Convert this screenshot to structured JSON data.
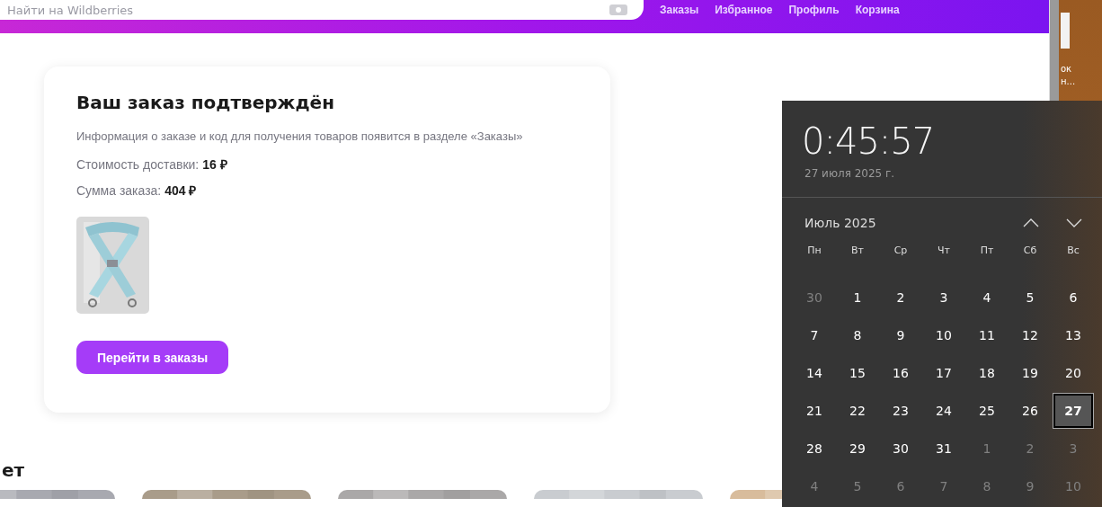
{
  "header": {
    "search": {
      "placeholder": "Найти на Wildberries"
    },
    "nav": [
      "Заказы",
      "Избранное",
      "Профиль",
      "Корзина"
    ]
  },
  "order_card": {
    "title": "Ваш заказ подтверждён",
    "info": "Информация о заказе и код для получения товаров появится в разделе «Заказы»",
    "lines": [
      {
        "label": "Стоимость доставки:",
        "value": "16 ₽"
      },
      {
        "label": "Сумма заказа:",
        "value": "404 ₽"
      }
    ],
    "button": "Перейти в заказы"
  },
  "section_heading": "ет",
  "desktop_icon": {
    "label": "ок\nн..."
  },
  "clock": {
    "time": "0:45:57",
    "date": "27 июля 2025 г.",
    "month": "Июль 2025",
    "weekdays": [
      "Пн",
      "Вт",
      "Ср",
      "Чт",
      "Пт",
      "Сб",
      "Вс"
    ],
    "weeks": [
      [
        {
          "day": "30",
          "in_month": false,
          "today": false
        },
        {
          "day": "1",
          "in_month": true,
          "today": false
        },
        {
          "day": "2",
          "in_month": true,
          "today": false
        },
        {
          "day": "3",
          "in_month": true,
          "today": false
        },
        {
          "day": "4",
          "in_month": true,
          "today": false
        },
        {
          "day": "5",
          "in_month": true,
          "today": false
        },
        {
          "day": "6",
          "in_month": true,
          "today": false
        }
      ],
      [
        {
          "day": "7",
          "in_month": true,
          "today": false
        },
        {
          "day": "8",
          "in_month": true,
          "today": false
        },
        {
          "day": "9",
          "in_month": true,
          "today": false
        },
        {
          "day": "10",
          "in_month": true,
          "today": false
        },
        {
          "day": "11",
          "in_month": true,
          "today": false
        },
        {
          "day": "12",
          "in_month": true,
          "today": false
        },
        {
          "day": "13",
          "in_month": true,
          "today": false
        }
      ],
      [
        {
          "day": "14",
          "in_month": true,
          "today": false
        },
        {
          "day": "15",
          "in_month": true,
          "today": false
        },
        {
          "day": "16",
          "in_month": true,
          "today": false
        },
        {
          "day": "17",
          "in_month": true,
          "today": false
        },
        {
          "day": "18",
          "in_month": true,
          "today": false
        },
        {
          "day": "19",
          "in_month": true,
          "today": false
        },
        {
          "day": "20",
          "in_month": true,
          "today": false
        }
      ],
      [
        {
          "day": "21",
          "in_month": true,
          "today": false
        },
        {
          "day": "22",
          "in_month": true,
          "today": false
        },
        {
          "day": "23",
          "in_month": true,
          "today": false
        },
        {
          "day": "24",
          "in_month": true,
          "today": false
        },
        {
          "day": "25",
          "in_month": true,
          "today": false
        },
        {
          "day": "26",
          "in_month": true,
          "today": false
        },
        {
          "day": "27",
          "in_month": true,
          "today": true
        }
      ],
      [
        {
          "day": "28",
          "in_month": true,
          "today": false
        },
        {
          "day": "29",
          "in_month": true,
          "today": false
        },
        {
          "day": "30",
          "in_month": true,
          "today": false
        },
        {
          "day": "31",
          "in_month": true,
          "today": false
        },
        {
          "day": "1",
          "in_month": false,
          "today": false
        },
        {
          "day": "2",
          "in_month": false,
          "today": false
        },
        {
          "day": "3",
          "in_month": false,
          "today": false
        }
      ],
      [
        {
          "day": "4",
          "in_month": false,
          "today": false
        },
        {
          "day": "5",
          "in_month": false,
          "today": false
        },
        {
          "day": "6",
          "in_month": false,
          "today": false
        },
        {
          "day": "7",
          "in_month": false,
          "today": false
        },
        {
          "day": "8",
          "in_month": false,
          "today": false
        },
        {
          "day": "9",
          "in_month": false,
          "today": false
        },
        {
          "day": "10",
          "in_month": false,
          "today": false
        }
      ]
    ]
  }
}
